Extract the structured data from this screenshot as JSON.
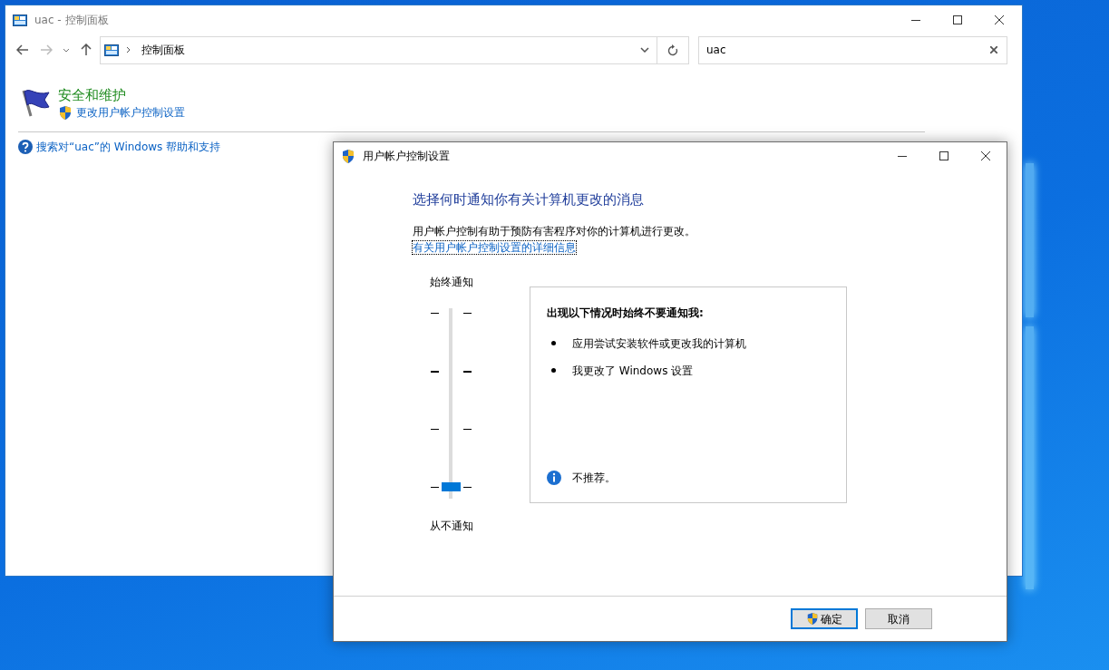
{
  "control_panel": {
    "title": "uac - 控制面板",
    "breadcrumb": "控制面板",
    "search": {
      "value": "uac"
    },
    "results": [
      {
        "heading": "安全和维护",
        "link": "更改用户帐户控制设置"
      }
    ],
    "help_link": "搜索对“uac”的 Windows 帮助和支持"
  },
  "uac_dialog": {
    "title": "用户帐户控制设置",
    "heading": "选择何时通知你有关计算机更改的消息",
    "description": "用户帐户控制有助于预防有害程序对你的计算机进行更改。",
    "details_link": "有关用户帐户控制设置的详细信息",
    "slider": {
      "top_label": "始终通知",
      "bottom_label": "从不通知",
      "level": 0
    },
    "info": {
      "heading": "出现以下情况时始终不要通知我:",
      "bullets": [
        "应用尝试安装软件或更改我的计算机",
        "我更改了 Windows 设置"
      ],
      "note": "不推荐。"
    },
    "buttons": [
      {
        "label": "确定",
        "kind": "shield",
        "focused": true
      },
      {
        "label": "取消",
        "kind": "plain",
        "focused": false
      }
    ]
  }
}
